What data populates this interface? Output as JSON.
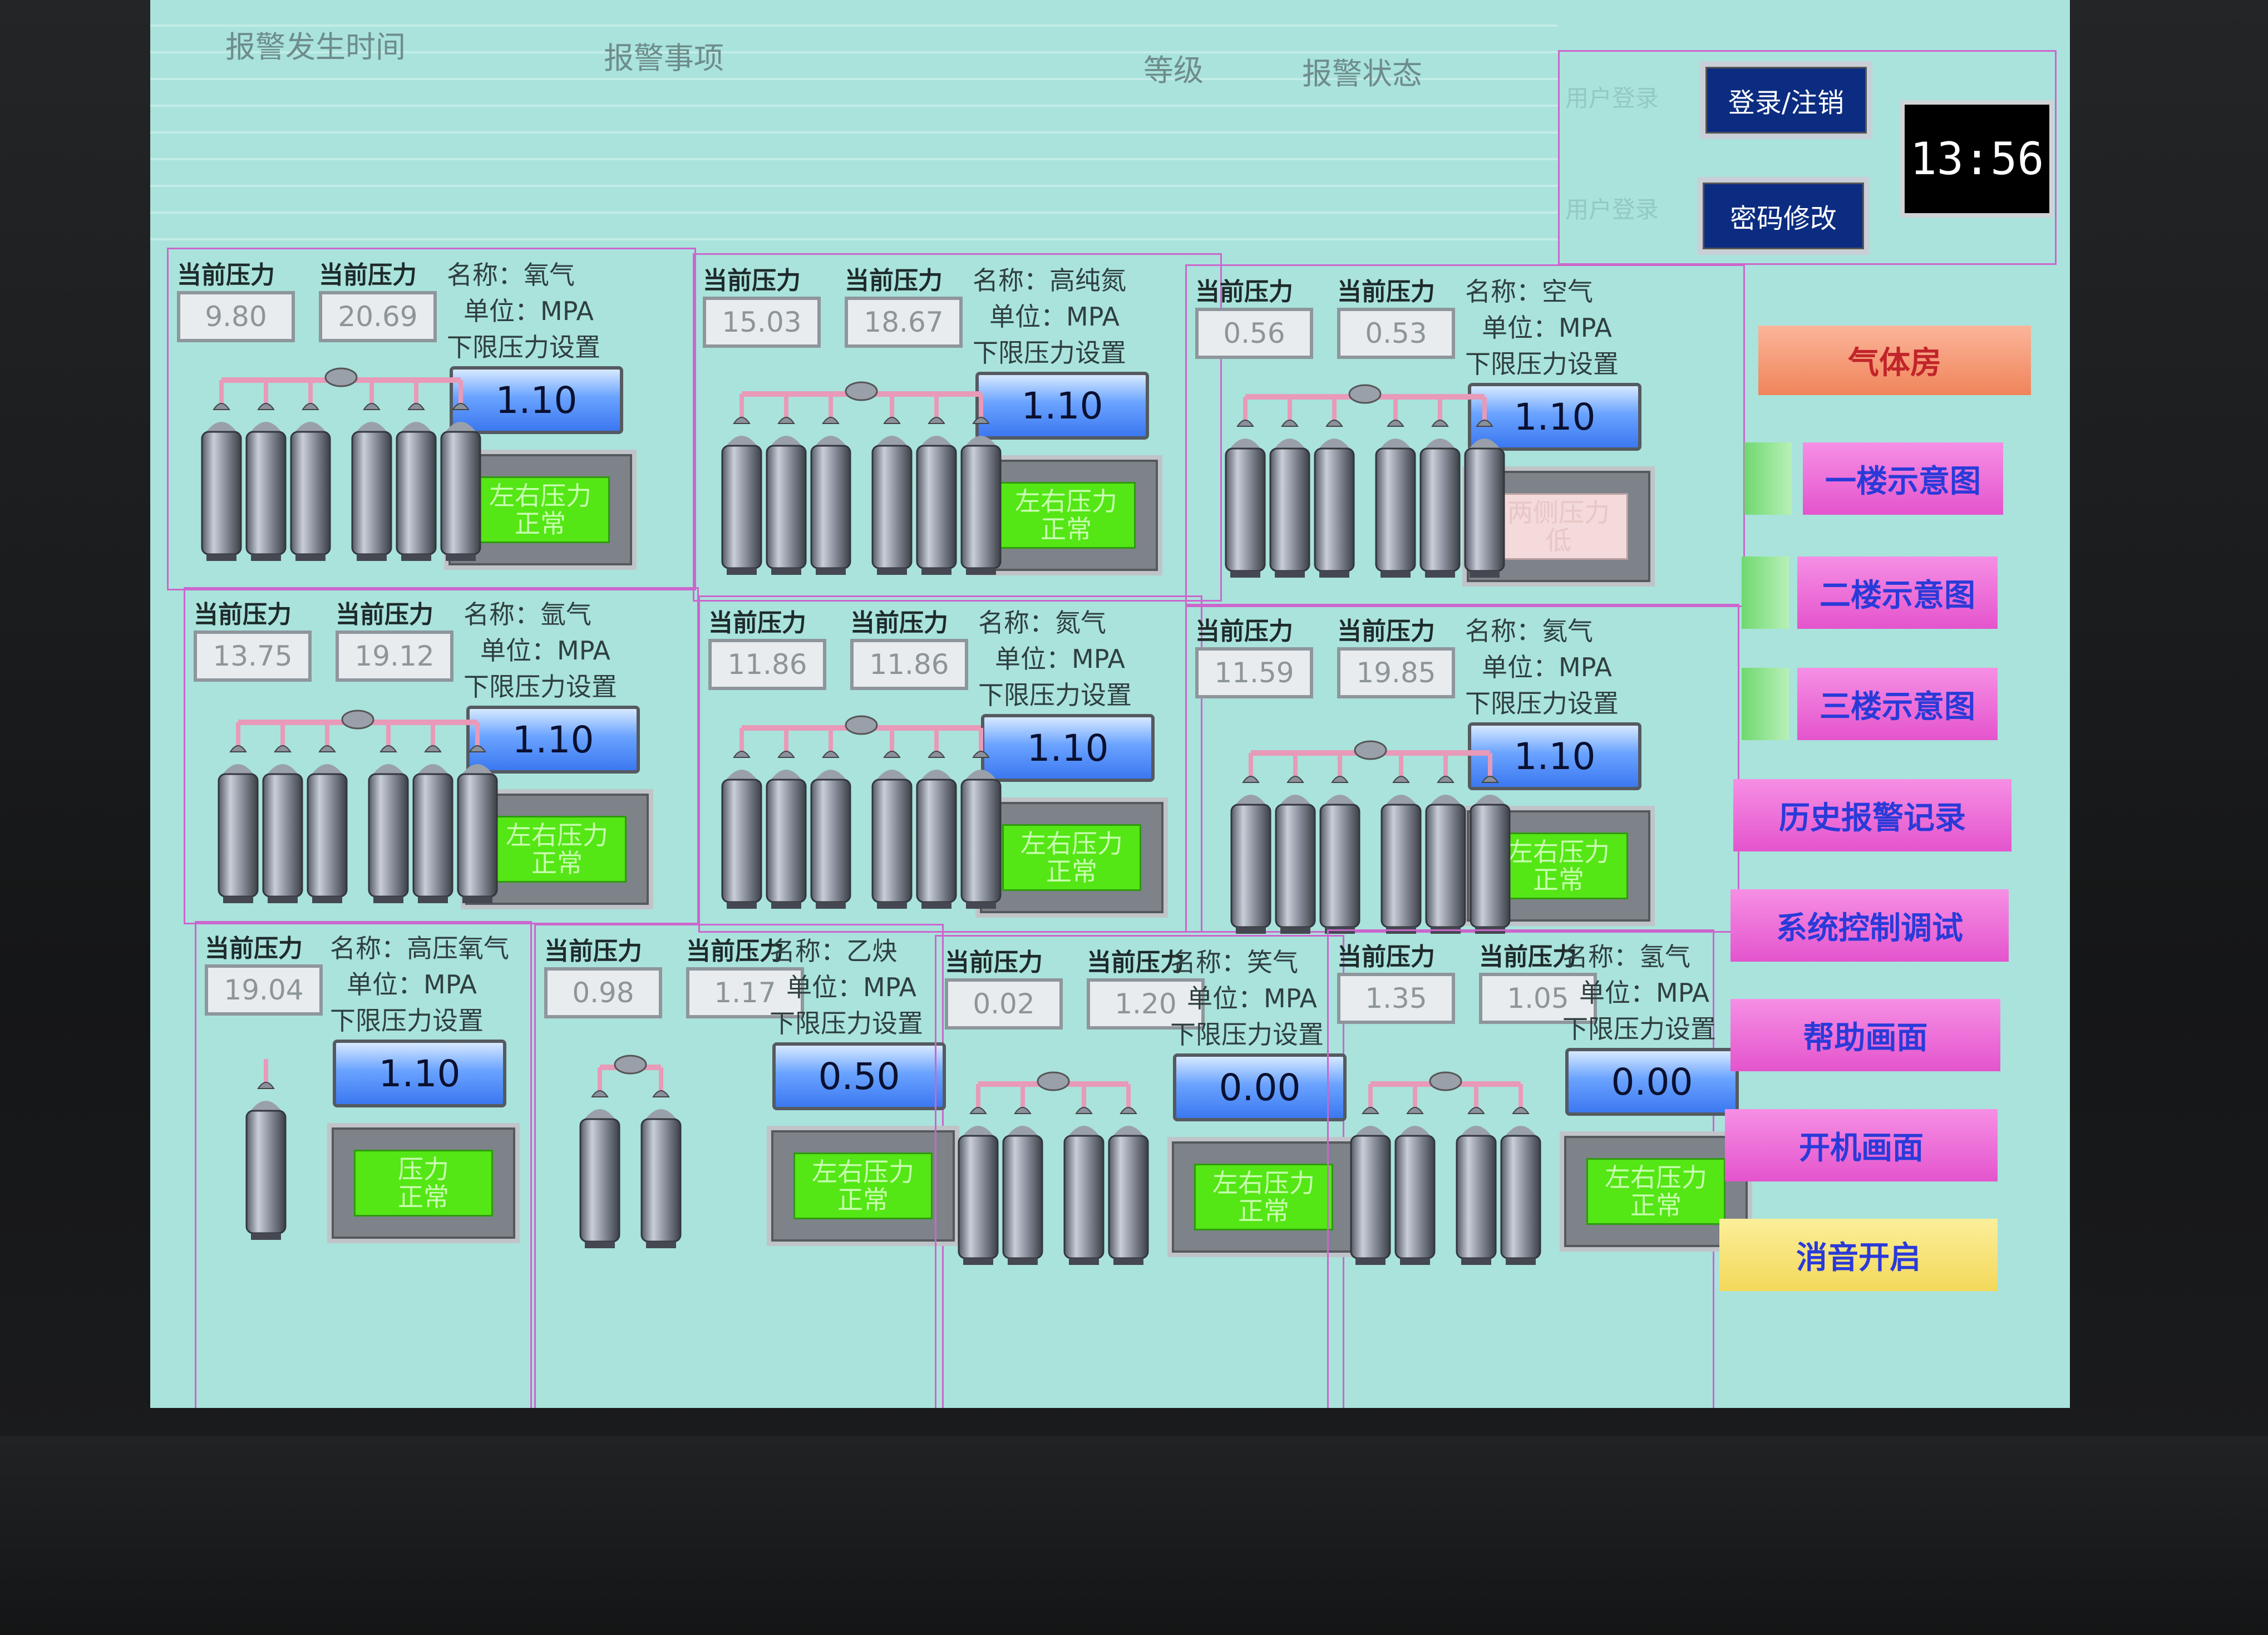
{
  "alarm_header": {
    "time": "报警发生时间",
    "item": "报警事项",
    "level": "等级",
    "state": "报警状态"
  },
  "login": {
    "user_label_1": "用户登录",
    "user_label_2": "用户登录",
    "login_button": "登录/注销",
    "password_button": "密码修改",
    "clock": "13:56"
  },
  "common": {
    "current_pressure": "当前压力",
    "unit": "单位：MPA",
    "lower_limit": "下限压力设置"
  },
  "panels": [
    {
      "name": "名称：氧气",
      "left": "9.80",
      "right": "20.69",
      "setpoint": "1.10",
      "status": [
        "左右压力",
        "正常"
      ]
    },
    {
      "name": "名称：高纯氮",
      "left": "15.03",
      "right": "18.67",
      "setpoint": "1.10",
      "status": [
        "左右压力",
        "正常"
      ]
    },
    {
      "name": "名称：空气",
      "left": "0.56",
      "right": "0.53",
      "setpoint": "1.10",
      "status": [
        "两侧压力",
        "低"
      ]
    },
    {
      "name": "名称：氩气",
      "left": "13.75",
      "right": "19.12",
      "setpoint": "1.10",
      "status": [
        "左右压力",
        "正常"
      ]
    },
    {
      "name": "名称：氮气",
      "left": "11.86",
      "right": "11.86",
      "setpoint": "1.10",
      "status": [
        "左右压力",
        "正常"
      ]
    },
    {
      "name": "名称：氦气",
      "left": "11.59",
      "right": "19.85",
      "setpoint": "1.10",
      "status": [
        "左右压力",
        "正常"
      ]
    },
    {
      "name": "名称：高压氧气",
      "left": "19.04",
      "setpoint": "1.10",
      "status": [
        "压力",
        "正常"
      ]
    },
    {
      "name": "名称：乙炔",
      "left": "0.98",
      "right": "1.17",
      "setpoint": "0.50",
      "status": [
        "左右压力",
        "正常"
      ]
    },
    {
      "name": "名称：笑气",
      "left": "0.02",
      "right": "1.20",
      "setpoint": "0.00",
      "status": [
        "左右压力",
        "正常"
      ]
    },
    {
      "name": "名称：氢气",
      "left": "1.35",
      "right": "1.05",
      "setpoint": "0.00",
      "status": [
        "左右压力",
        "正常"
      ]
    }
  ],
  "nav": {
    "gas_room": "气体房",
    "floor1": "一楼示意图",
    "floor2": "二楼示意图",
    "floor3": "三楼示意图",
    "history": "历史报警记录",
    "system": "系统控制调试",
    "help": "帮助画面",
    "startup": "开机画面",
    "mute": "消音开启"
  },
  "colors": {
    "screen_bg": "#a9e3dc",
    "panel_border": "#cc66cc",
    "status_ok": "#55e615",
    "status_low": "#f4dada",
    "setpoint": "#3b78f0",
    "nav_pink": "#ee66d8",
    "nav_orange": "#f59a70",
    "nav_yellow": "#f5e070",
    "login_btn": "#0b2c80"
  }
}
